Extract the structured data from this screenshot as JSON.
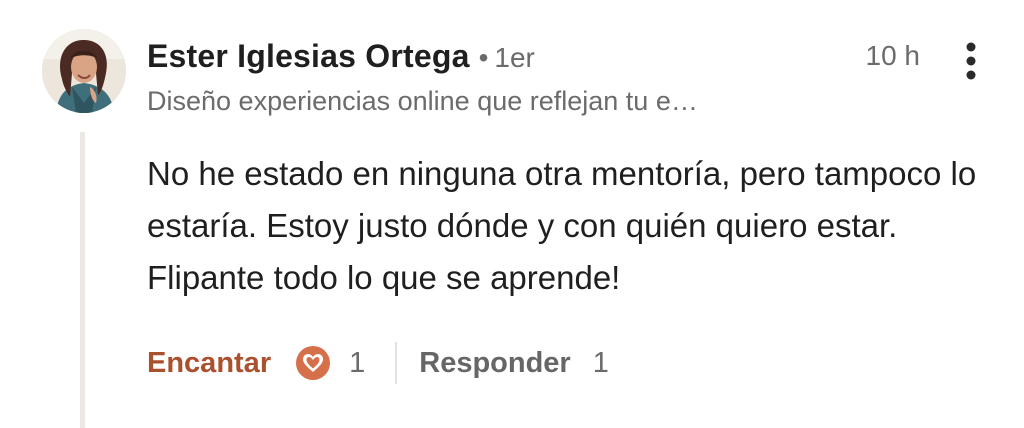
{
  "comment": {
    "author": {
      "name": "Ester Iglesias Ortega",
      "separator": "•",
      "degree": "1er",
      "headline": "Diseño experiencias online que reflejan tu e…"
    },
    "timestamp": "10 h",
    "more_icon": "more-vert-icon",
    "text": "No he estado en ninguna otra mentoría, pero tampoco lo estaría. Estoy justo dónde y con quién quiero estar. Flipante todo lo que se aprende!",
    "actions": {
      "like_label": "Encantar",
      "reaction_icon": "heart-reaction-icon",
      "like_count": "1",
      "reply_label": "Responder",
      "reply_count": "1"
    }
  },
  "colors": {
    "like_accent": "#a9502e",
    "heart_orange": "#d5704a",
    "secondary_text": "#6b6b6b",
    "primary_text": "#1f1f1f"
  }
}
